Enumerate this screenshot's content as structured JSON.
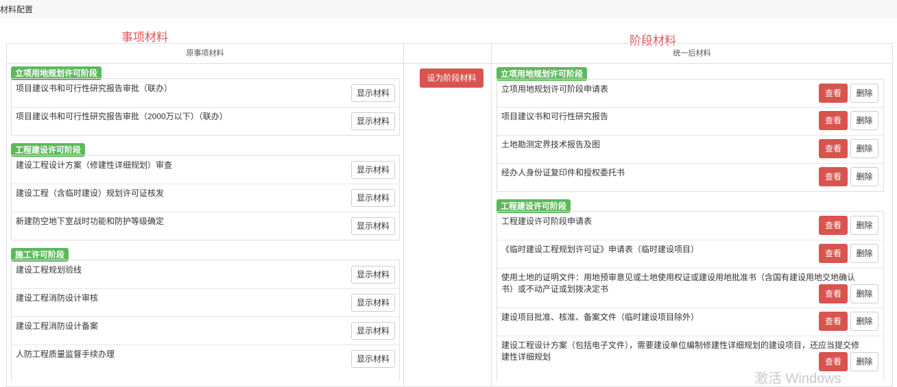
{
  "header": {
    "title": "材料配置"
  },
  "annotations": {
    "left": "事项材料",
    "right": "阶段材料"
  },
  "columns": {
    "left": "原事项材料",
    "right": "统一后材料"
  },
  "buttons": {
    "set_stage": "设为阶段材料",
    "show": "显示材料",
    "view": "查看",
    "delete": "删除"
  },
  "left_groups": [
    {
      "label": "立项用地规划许可阶段",
      "items": [
        "项目建议书和可行性研究报告审批（联办）",
        "项目建议书和可行性研究报告审批（2000万以下）（联办）"
      ]
    },
    {
      "label": "工程建设许可阶段",
      "items": [
        "建设工程设计方案（修建性详细规划）审查",
        "建设工程（含临时建设）规划许可证核发",
        "新建防空地下室战时功能和防护等级确定"
      ]
    },
    {
      "label": "施工许可阶段",
      "items": [
        "建设工程规划验线",
        "建设工程消防设计审核",
        "建设工程消防设计备案",
        "人防工程质量监督手续办理"
      ]
    }
  ],
  "right_groups": [
    {
      "label": "立项用地规划许可阶段",
      "items": [
        "立项用地规划许可阶段申请表",
        "项目建议书和可行性研究报告",
        "土地勘测定界技术报告及图",
        "经办人身份证复印件和授权委托书"
      ]
    },
    {
      "label": "工程建设许可阶段",
      "items": [
        "工程建设许可阶段申请表",
        "《临时建设工程规划许可证》申请表（临时建设项目）",
        "使用土地的证明文件：用地预审意见或土地使用权证或建设用地批准书（含国有建设用地交地确认书）或不动产证或划拨决定书",
        "建设项目批准、核准、备案文件（临时建设项目除外）",
        "建设工程设计方案（包括电子文件），需要建设单位编制修建性详细规划的建设项目，还应当提交修建性详细规划"
      ]
    }
  ],
  "watermark": "激活 Windows"
}
